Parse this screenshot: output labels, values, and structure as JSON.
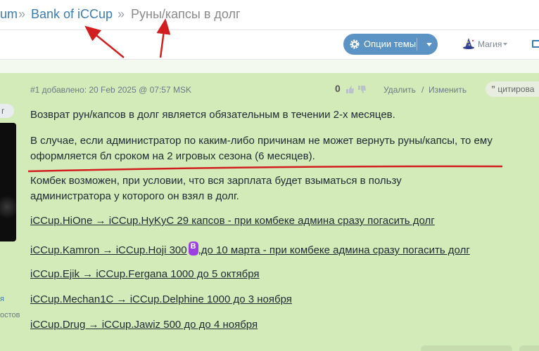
{
  "breadcrumb": {
    "partial": "um",
    "separator": "»",
    "parent": "Bank of iCCup",
    "current": "Руны/капсы в долг"
  },
  "toolbar": {
    "options_label": "Опции темы",
    "magic_label": "Магия"
  },
  "sidebar": {
    "label_top": "г",
    "link_partial": "я",
    "text_partial": "остов"
  },
  "post": {
    "meta": "#1 добавлено: 20 Feb 2025 @ 07:57 MSK",
    "score": "0",
    "delete_label": "Удалить",
    "action_separator": "/",
    "edit_label": "Изменить",
    "quote_label": "цитирова",
    "paragraphs": [
      "Возврат рун/капсов в долг является обязательным в течении 2-х месяцев.",
      "В случае, если администратор по каким-либо причинам не может вернуть руны/капсы, то ему оформляется бл сроком на 2 игровых сезона (6 месяцев).",
      "Комбек возможен, при условии, что вся зарплата будет взыматься в пользу администратора у которого он взял в долг."
    ],
    "debts": [
      "iCCup.HiOne → iCCup.HyKyC 29 капсов - при комбеке админа сразу погасить долг",
      "iCCup.Kamron → iCCup.Hoji 300",
      ",до 10 марта - при комбеке админа сразу погасить долг",
      "iCCup.Ejik → iCCup.Fergana 1000 до 5 октября",
      "iCCup.Mechan1C → iCCup.Delphine 1000 до 3 ноября",
      "iCCup.Drug → iCCup.Jawiz 500 до до 4 ноября"
    ]
  },
  "colors": {
    "post_bg": "#d3eab9",
    "link_blue": "#3b7cb3",
    "button_blue": "#5a93c4",
    "annotation_red": "#d11f1f"
  }
}
